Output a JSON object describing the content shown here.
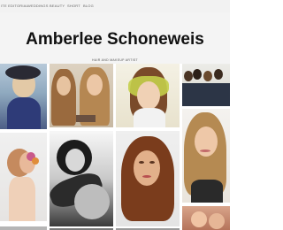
{
  "nav": {
    "items": [
      "ITE EDITORIAL",
      "WEDDINGS",
      "BEAUTY",
      "SHORT",
      "BLOG"
    ]
  },
  "header": {
    "title": "Amberlee Schoneweis",
    "subtitle": "HAIR AND MAKEUP ARTIST"
  },
  "gallery": {
    "count": 12
  }
}
